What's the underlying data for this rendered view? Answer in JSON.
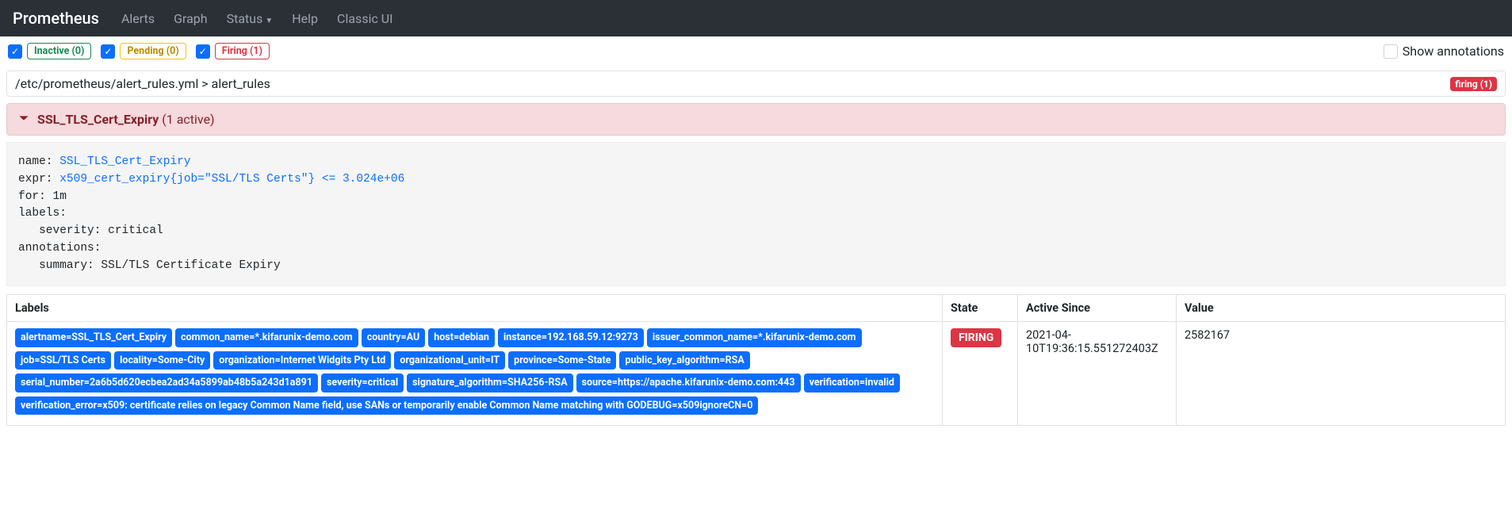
{
  "nav": {
    "brand": "Prometheus",
    "links": [
      "Alerts",
      "Graph",
      "Status",
      "Help",
      "Classic UI"
    ],
    "status_has_dropdown": true
  },
  "filters": {
    "inactive": {
      "label": "Inactive (0)",
      "checked": true
    },
    "pending": {
      "label": "Pending (0)",
      "checked": true
    },
    "firing": {
      "label": "Firing (1)",
      "checked": true
    },
    "show_annotations": {
      "label": "Show annotations",
      "checked": false
    }
  },
  "group": {
    "path": "/etc/prometheus/alert_rules.yml > alert_rules",
    "firing_badge": "firing (1)"
  },
  "alert": {
    "name": "SSL_TLS_Cert_Expiry",
    "active_suffix": "(1 active)",
    "rule": {
      "name_key": "name: ",
      "name_val": "SSL_TLS_Cert_Expiry",
      "expr_key": "expr: ",
      "expr_val": "x509_cert_expiry{job=\"SSL/TLS Certs\"} <= 3.024e+06",
      "for_line": "for: 1m",
      "labels_line": "labels:",
      "severity_line": "   severity: critical",
      "annotations_line": "annotations:",
      "summary_line": "   summary: SSL/TLS Certificate Expiry"
    }
  },
  "table": {
    "headers": {
      "labels": "Labels",
      "state": "State",
      "since": "Active Since",
      "value": "Value"
    },
    "row": {
      "labels": [
        "alertname=SSL_TLS_Cert_Expiry",
        "common_name=*.kifarunix-demo.com",
        "country=AU",
        "host=debian",
        "instance=192.168.59.12:9273",
        "issuer_common_name=*.kifarunix-demo.com",
        "job=SSL/TLS Certs",
        "locality=Some-City",
        "organization=Internet Widgits Pty Ltd",
        "organizational_unit=IT",
        "province=Some-State",
        "public_key_algorithm=RSA",
        "serial_number=2a6b5d620ecbea2ad34a5899ab48b5a243d1a891",
        "severity=critical",
        "signature_algorithm=SHA256-RSA",
        "source=https://apache.kifarunix-demo.com:443",
        "verification=invalid",
        "verification_error=x509: certificate relies on legacy Common Name field, use SANs or temporarily enable Common Name matching with GODEBUG=x509ignoreCN=0"
      ],
      "state": "FIRING",
      "since": "2021-04-10T19:36:15.551272403Z",
      "value": "2582167"
    }
  }
}
